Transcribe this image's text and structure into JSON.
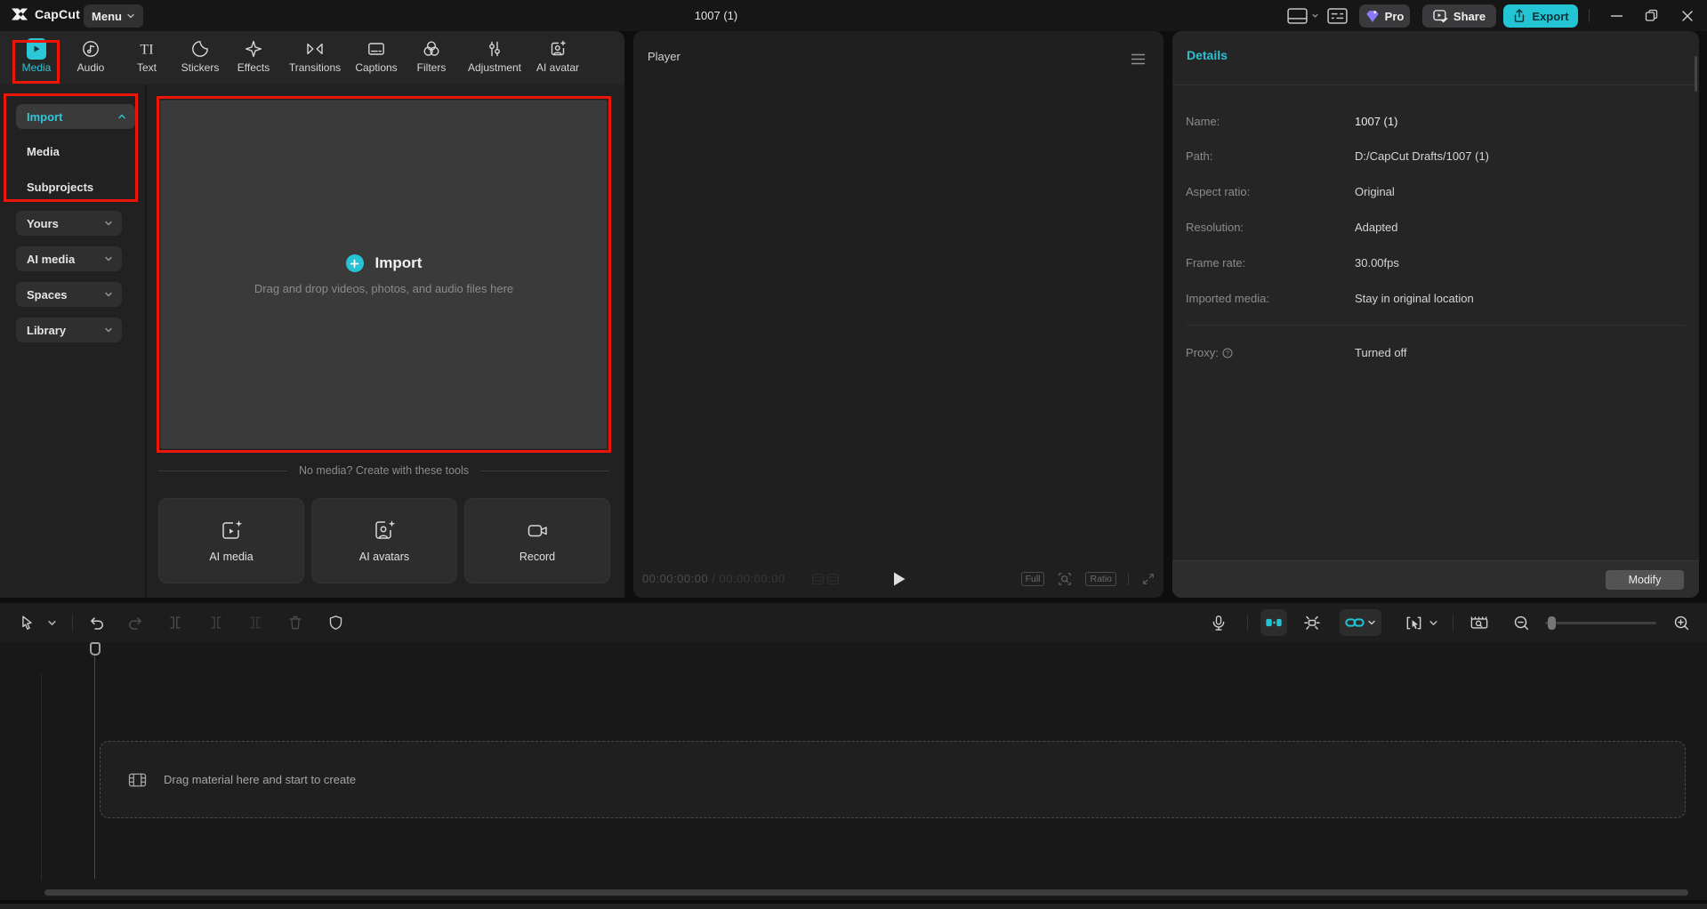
{
  "title_bar": {
    "app_name": "CapCut",
    "menu_label": "Menu",
    "document_title": "1007 (1)",
    "pro_label": "Pro",
    "share_label": "Share",
    "export_label": "Export"
  },
  "tabs": {
    "items": [
      {
        "label": "Media",
        "active": true
      },
      {
        "label": "Audio",
        "active": false
      },
      {
        "label": "Text",
        "active": false
      },
      {
        "label": "Stickers",
        "active": false
      },
      {
        "label": "Effects",
        "active": false
      },
      {
        "label": "Transitions",
        "active": false
      },
      {
        "label": "Captions",
        "active": false
      },
      {
        "label": "Filters",
        "active": false
      },
      {
        "label": "Adjustment",
        "active": false
      },
      {
        "label": "AI avatar",
        "active": false
      }
    ]
  },
  "sidebar": {
    "items": [
      {
        "label": "Import",
        "state": "expanded"
      },
      {
        "label": "Media"
      },
      {
        "label": "Subprojects"
      },
      {
        "label": "Yours",
        "state": "collapsed"
      },
      {
        "label": "AI media",
        "state": "collapsed"
      },
      {
        "label": "Spaces",
        "state": "collapsed"
      },
      {
        "label": "Library",
        "state": "collapsed"
      }
    ]
  },
  "import_area": {
    "import_label": "Import",
    "drop_hint": "Drag and drop videos, photos, and audio files here",
    "no_media_text": "No media? Create with these tools",
    "tools": [
      {
        "label": "AI media"
      },
      {
        "label": "AI avatars"
      },
      {
        "label": "Record"
      }
    ]
  },
  "player": {
    "title": "Player",
    "timecode_current": "00:00:00:00",
    "timecode_separator": " / ",
    "timecode_total": "00:00:00:00",
    "full_label": "Full",
    "ratio_label": "Ratio"
  },
  "details": {
    "title": "Details",
    "rows": [
      {
        "label": "Name:",
        "value": "1007 (1)"
      },
      {
        "label": "Path:",
        "value": "D:/CapCut Drafts/1007 (1)"
      },
      {
        "label": "Aspect ratio:",
        "value": "Original"
      },
      {
        "label": "Resolution:",
        "value": "Adapted"
      },
      {
        "label": "Frame rate:",
        "value": "30.00fps"
      },
      {
        "label": "Imported media:",
        "value": "Stay in original location"
      }
    ],
    "proxy_label": "Proxy:",
    "proxy_value": "Turned off",
    "modify_label": "Modify"
  },
  "timeline": {
    "drop_hint": "Drag material here and start to create"
  },
  "colors": {
    "accent": "#2bc6d7",
    "annotation_red": "#ec1506",
    "export_button": "#23c4d4",
    "pro_gem": "#8b7af7"
  }
}
